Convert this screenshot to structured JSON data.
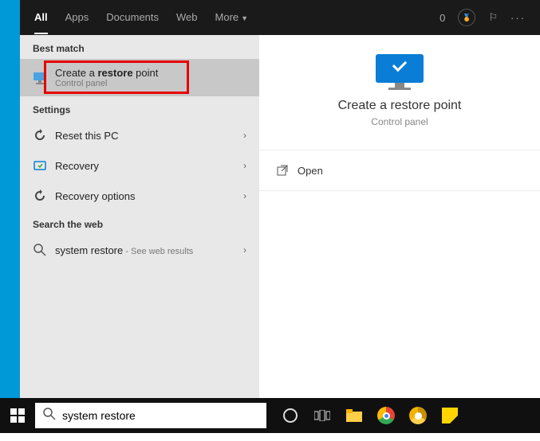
{
  "top": {
    "tabs": [
      "All",
      "Apps",
      "Documents",
      "Web",
      "More"
    ],
    "count": "0"
  },
  "left": {
    "best": "Best match",
    "main": {
      "pre": "Create a ",
      "bold": "restore",
      "post": " point",
      "sub": "Control panel"
    },
    "settings": "Settings",
    "items": [
      {
        "label": "Reset this PC"
      },
      {
        "label": "Recovery"
      },
      {
        "label": "Recovery options"
      }
    ],
    "web": "Search the web",
    "webitem": {
      "label": "system restore",
      "hint": " - See web results"
    }
  },
  "right": {
    "title": "Create a restore point",
    "sub": "Control panel",
    "open": "Open"
  },
  "search": {
    "value": "system restore"
  }
}
